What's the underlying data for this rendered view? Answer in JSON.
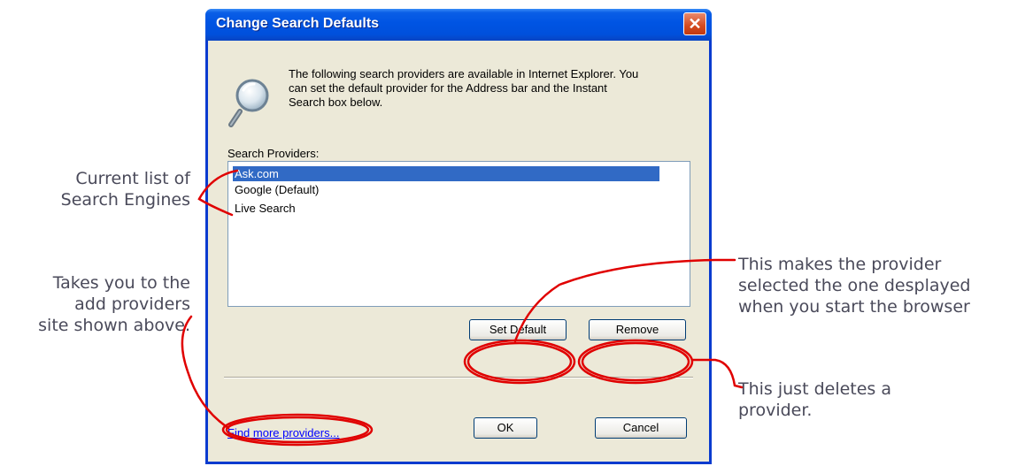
{
  "dialog": {
    "title": "Change Search Defaults",
    "close_glyph": "✕",
    "intro": "The following search providers are available in Internet Explorer.  You can set the default provider for the Address bar and the Instant Search box below.",
    "providers_label": "Search Providers:",
    "providers": [
      {
        "name": "Ask.com",
        "selected": true
      },
      {
        "name": "Google (Default)",
        "selected": false
      },
      {
        "name": "Live Search",
        "selected": false
      }
    ],
    "buttons": {
      "set_default": "Set Default",
      "remove": "Remove",
      "ok": "OK",
      "cancel": "Cancel"
    },
    "find_more_link": "Find more providers...",
    "icon": "magnifier-icon"
  },
  "annotations": {
    "list": "Current list of\nSearch Engines",
    "find_more": "Takes you to the\nadd providers\nsite shown above.",
    "set_default": "This makes the provider\nselected the one desplayed\nwhen you start the browser",
    "remove": "This just deletes a\nprovider.",
    "color": "#e00000"
  },
  "colors": {
    "title_bar": "#0054e3",
    "selection": "#316ac5",
    "dialog_face": "#ece9d8"
  }
}
